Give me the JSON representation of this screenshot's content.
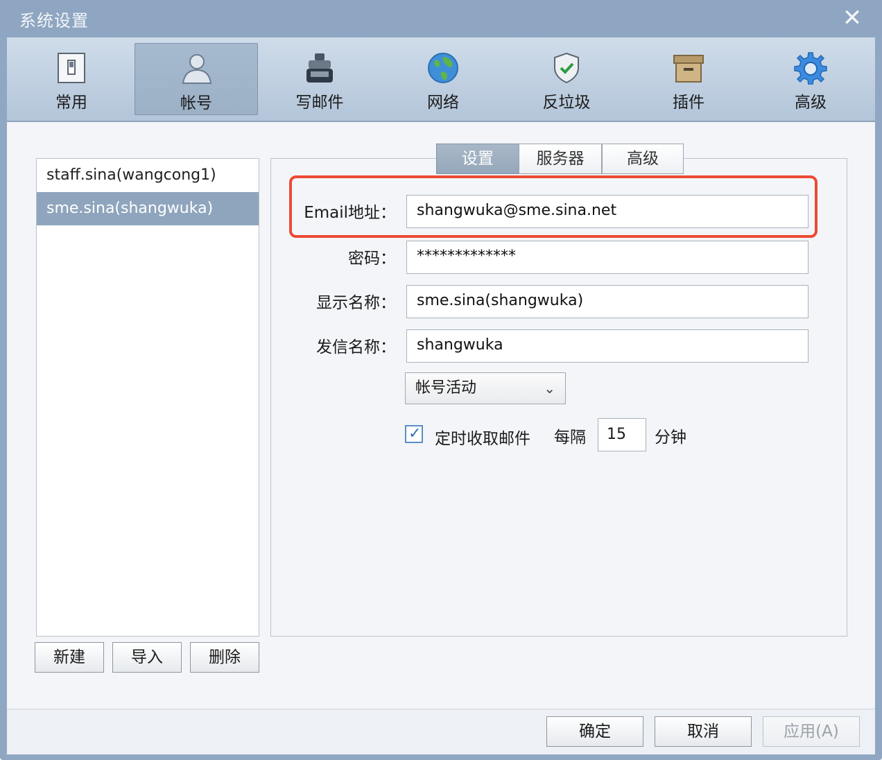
{
  "window": {
    "title": "系统设置",
    "close_symbol": "✕"
  },
  "toolbar": {
    "items": [
      {
        "label": "常用",
        "icon": "switch-icon"
      },
      {
        "label": "帐号",
        "icon": "user-icon",
        "active": true
      },
      {
        "label": "写邮件",
        "icon": "ink-bottle-icon"
      },
      {
        "label": "网络",
        "icon": "globe-icon"
      },
      {
        "label": "反垃圾",
        "icon": "shield-icon"
      },
      {
        "label": "插件",
        "icon": "box-icon"
      },
      {
        "label": "高级",
        "icon": "gear-icon"
      }
    ]
  },
  "accounts": {
    "items": [
      "staff.sina(wangcong1)",
      "sme.sina(shangwuka)"
    ],
    "selected_index": 1,
    "buttons": {
      "new": "新建",
      "import": "导入",
      "delete": "删除"
    }
  },
  "tabs": [
    "设置",
    "服务器",
    "高级"
  ],
  "form": {
    "email_label": "Email地址：",
    "email_value": "shangwuka@sme.sina.net",
    "password_label": "密码：",
    "password_value": "*************",
    "display_name_label": "显示名称：",
    "display_name_value": "sme.sina(shangwuka)",
    "sender_name_label": "发信名称：",
    "sender_name_value": "shangwuka",
    "status_select": "帐号活动",
    "auto_fetch_label": "定时收取邮件",
    "auto_fetch_checked": true,
    "every_label": "每隔",
    "interval_value": "15",
    "minutes_label": "分钟"
  },
  "footer": {
    "ok": "确定",
    "cancel": "取消",
    "apply": "应用(A)"
  },
  "colors": {
    "accent": "#8fa5bd",
    "highlight": "#ec4a34"
  }
}
